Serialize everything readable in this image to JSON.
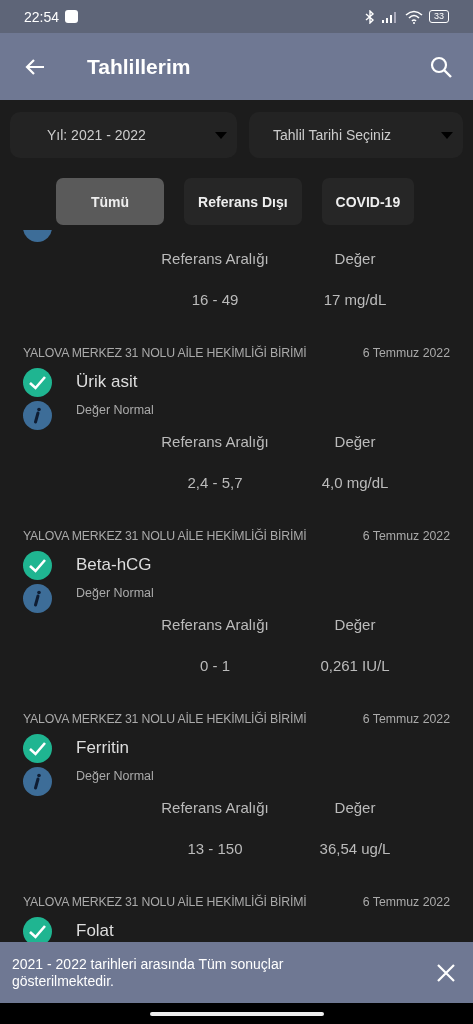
{
  "status_bar": {
    "time": "22:54",
    "battery": "33"
  },
  "app_bar": {
    "title": "Tahlillerim"
  },
  "filters": [
    {
      "label": "Yıl: 2021 - 2022"
    },
    {
      "label": "Tahlil Tarihi Seçiniz"
    }
  ],
  "tabs": [
    {
      "label": "Tümü",
      "selected": true
    },
    {
      "label": "Referans Dışı",
      "selected": false
    },
    {
      "label": "COVID-19",
      "selected": false
    }
  ],
  "clipped_result": {
    "range_label": "Referans Aralığı",
    "value_label": "Değer",
    "range": "16 - 49",
    "value": "17 mg/dL"
  },
  "results": [
    {
      "facility": "YALOVA MERKEZ 31 NOLU AİLE HEKİMLİĞİ BİRİMİ",
      "date": "6 Temmuz 2022",
      "name": "Ürik asit",
      "in_range": true,
      "status_text": "Değer Normal",
      "range_label": "Referans Aralığı",
      "value_label": "Değer",
      "range": "2,4 - 5,7",
      "value": "4,0 mg/dL"
    },
    {
      "facility": "YALOVA MERKEZ 31 NOLU AİLE HEKİMLİĞİ BİRİMİ",
      "date": "6 Temmuz 2022",
      "name": "Beta-hCG",
      "in_range": true,
      "status_text": "Değer Normal",
      "range_label": "Referans Aralığı",
      "value_label": "Değer",
      "range": "0 - 1",
      "value": "0,261 IU/L"
    },
    {
      "facility": "YALOVA MERKEZ 31 NOLU AİLE HEKİMLİĞİ BİRİMİ",
      "date": "6 Temmuz 2022",
      "name": "Ferritin",
      "in_range": true,
      "status_text": "Değer Normal",
      "range_label": "Referans Aralığı",
      "value_label": "Değer",
      "range": "13 - 150",
      "value": "36,54 ug/L"
    },
    {
      "facility": "YALOVA MERKEZ 31 NOLU AİLE HEKİMLİĞİ BİRİMİ",
      "date": "6 Temmuz 2022",
      "name": "Folat",
      "in_range": true
    }
  ],
  "snackbar": {
    "message": "2021 - 2022 tarihleri arasında Tüm sonuçlar gösterilmektedir."
  }
}
